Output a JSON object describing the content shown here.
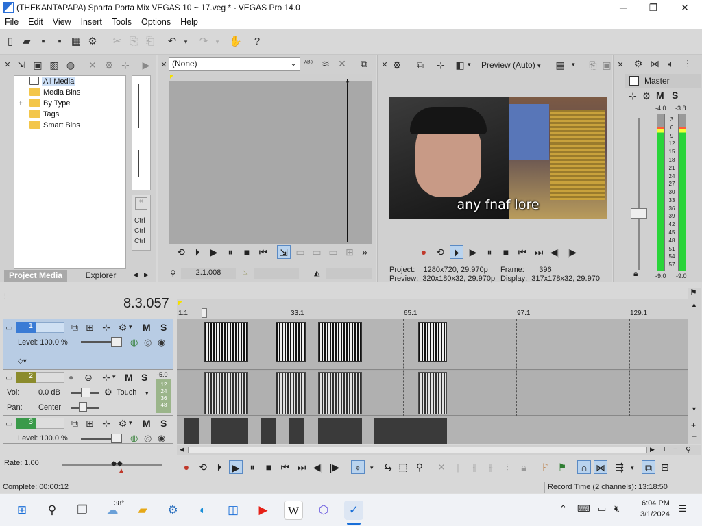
{
  "window": {
    "title": "(THEKANTAPAPA) Sparta Porta Mix VEGAS 10 ~ 17.veg * - VEGAS Pro 14.0",
    "minimize": "─",
    "maximize": "❐",
    "close": "✕"
  },
  "menu": [
    "File",
    "Edit",
    "View",
    "Insert",
    "Tools",
    "Options",
    "Help"
  ],
  "project_media": {
    "tree": [
      {
        "label": "All Media",
        "selected": true
      },
      {
        "label": "Media Bins"
      },
      {
        "label": "By Type",
        "expandable": true
      },
      {
        "label": "Tags"
      },
      {
        "label": "Smart Bins"
      }
    ],
    "ctrl_labels": [
      "Ctrl",
      "Ctrl",
      "Ctrl"
    ],
    "tabs": [
      "Project Media",
      "Explorer"
    ]
  },
  "trimmer": {
    "select_value": "(None)",
    "timecode": "2.1.008"
  },
  "preview": {
    "mode": "Preview (Auto)",
    "caption": "any fnaf lore",
    "project_label": "Project:",
    "project_value": "1280x720, 29.970p",
    "preview_label": "Preview:",
    "preview_value": "320x180x32, 29.970p",
    "frame_label": "Frame:",
    "frame_value": "396",
    "display_label": "Display:",
    "display_value": "317x178x32, 29.970"
  },
  "master": {
    "label": "Master",
    "mute": "M",
    "solo": "S",
    "peak_left": "-4.0",
    "peak_right": "-3.8",
    "scale": [
      "3",
      "6",
      "9",
      "12",
      "15",
      "18",
      "21",
      "24",
      "27",
      "30",
      "33",
      "36",
      "39",
      "42",
      "45",
      "48",
      "51",
      "54",
      "57"
    ],
    "bottom_left": "-9.0",
    "bottom_right": "-9.0",
    "level_left": 0.92,
    "level_right": 0.92
  },
  "timeline": {
    "position": "8.3.057",
    "ruler": [
      "1.1",
      "33.1",
      "65.1",
      "97.1",
      "129.1"
    ],
    "tracks": [
      {
        "number": "1",
        "type": "video",
        "level": "Level: 100.0 %",
        "mute": "M",
        "solo": "S"
      },
      {
        "number": "2",
        "type": "audio",
        "vol_label": "Vol:",
        "vol_value": "0.0 dB",
        "pan_label": "Pan:",
        "pan_value": "Center",
        "automation": "Touch",
        "mute": "M",
        "solo": "S",
        "meter_top": "-5.0",
        "meter_scale": [
          "12",
          "24",
          "36",
          "48"
        ]
      },
      {
        "number": "3",
        "type": "video",
        "level": "Level: 100.0 %",
        "mute": "M",
        "solo": "S"
      }
    ],
    "rate": "Rate: 1.00"
  },
  "status": {
    "complete": "Complete: 00:00:12",
    "record_time": "Record Time (2 channels): 13:18:50"
  },
  "taskbar": {
    "weather": "38°",
    "time": "6:04 PM",
    "date": "3/1/2024"
  },
  "colors": {
    "accent": "#2b6fd6",
    "track_selected": "#b8cce4",
    "meter_green": "#2ad43a"
  }
}
